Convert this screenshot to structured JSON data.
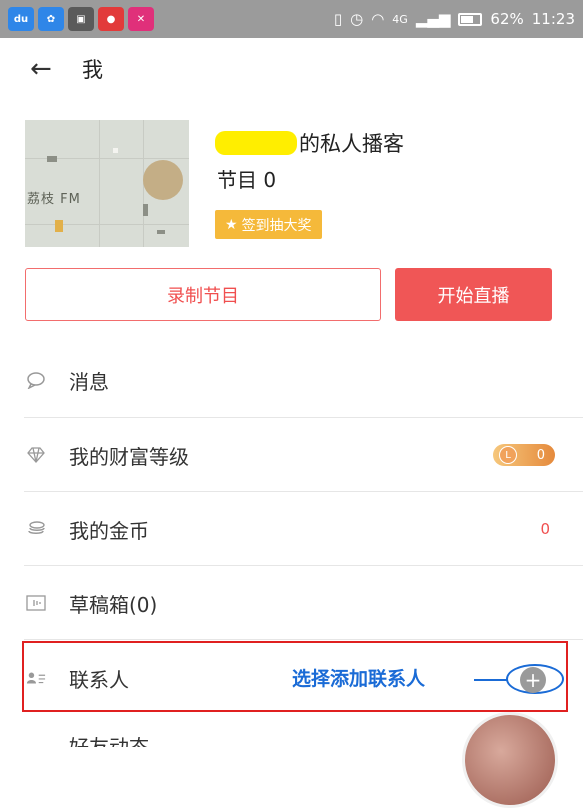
{
  "status_bar": {
    "apps": [
      {
        "name": "du",
        "color": "#2f86e8"
      },
      {
        "name": "baidu",
        "color": "#2f86e8"
      },
      {
        "name": "gallery",
        "color": "#5a5a5a"
      },
      {
        "name": "tomato",
        "color": "#e23a3a"
      },
      {
        "name": "k",
        "color": "#e0307a"
      }
    ],
    "network": "4G",
    "battery": "62%",
    "time": "11:23"
  },
  "header": {
    "title": "我"
  },
  "profile": {
    "username_suffix": "的私人播客",
    "program_count": "节目 0",
    "signin_label": "签到抽大奖",
    "cover_logo": "荔枝 FM"
  },
  "actions": {
    "record_label": "录制节目",
    "live_label": "开始直播"
  },
  "menu": [
    {
      "key": "messages",
      "label": "消息",
      "icon": "chat-bubble-icon"
    },
    {
      "key": "wealth",
      "label": "我的财富等级",
      "icon": "diamond-icon",
      "value": "0"
    },
    {
      "key": "coins",
      "label": "我的金币",
      "icon": "coins-icon",
      "value": "0"
    },
    {
      "key": "drafts",
      "label": "草稿箱(0)",
      "icon": "waveform-icon"
    },
    {
      "key": "contacts",
      "label": "联系人",
      "icon": "contact-card-icon"
    }
  ],
  "annotation": {
    "text": "选择添加联系人"
  },
  "partial_item": {
    "label": "好友动态"
  },
  "colors": {
    "accent": "#f05656",
    "annotation_blue": "#1a6bd6",
    "badge_yellow": "#f5b93a"
  }
}
